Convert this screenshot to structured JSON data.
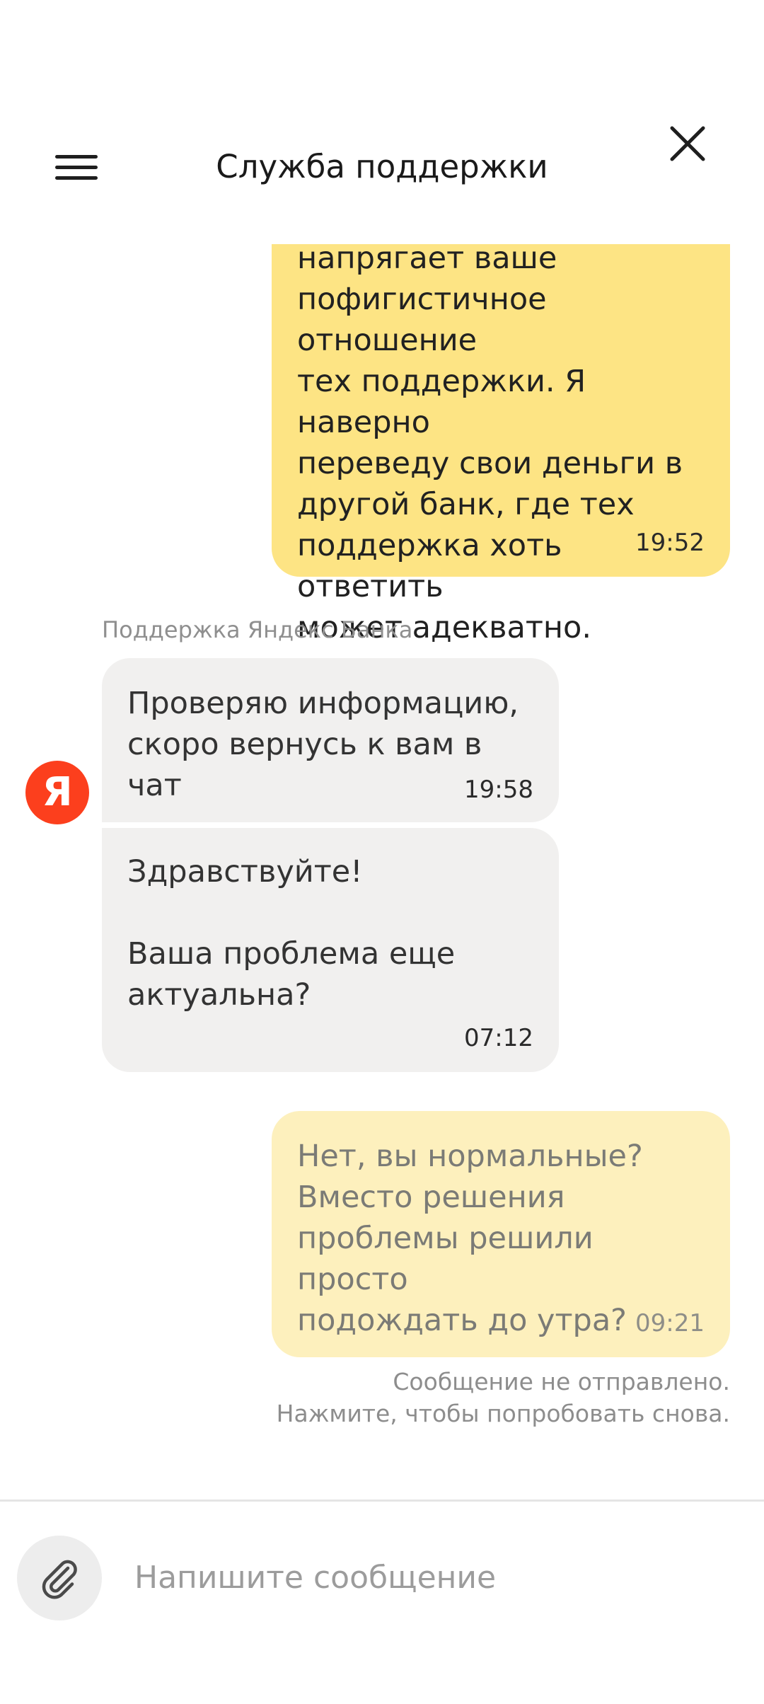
{
  "header": {
    "title": "Служба поддержки",
    "menu_icon": "hamburger-menu-icon",
    "close_icon": "close-icon"
  },
  "messages": [
    {
      "direction": "outgoing",
      "text": "напрягает ваше\nпофигистичное отношение\nтех поддержки. Я наверно\nпереведу свои деньги в\nдругой банк, где тех\nподдержка хоть ответить\nможет адекватно.",
      "time": "19:52"
    },
    {
      "direction": "incoming",
      "text": "Проверяю информацию,\nскоро вернусь к вам в чат",
      "time": "19:58"
    },
    {
      "direction": "incoming",
      "text": "Здравствуйте!\n\nВаша проблема еще\nактуальна?",
      "time": "07:12"
    },
    {
      "direction": "outgoing",
      "status": "failed",
      "text": "Нет, вы нормальные?\nВместо решения\nпроблемы решили просто\nподождать до утра?",
      "time": "09:21"
    }
  ],
  "sender_name": "Поддержка Яндекс Банка",
  "avatar_letter": "Я",
  "failed_note": "Сообщение не отправлено.\nНажмите, чтобы попробовать снова.",
  "composer": {
    "placeholder": "Напишите сообщение",
    "value": "",
    "attach_icon": "paperclip-icon"
  },
  "colors": {
    "outgoing_bubble": "#fde484",
    "outgoing_failed_bubble": "#fdf0bd",
    "incoming_bubble": "#f1f0ef",
    "avatar_bg": "#fc3f1d"
  }
}
